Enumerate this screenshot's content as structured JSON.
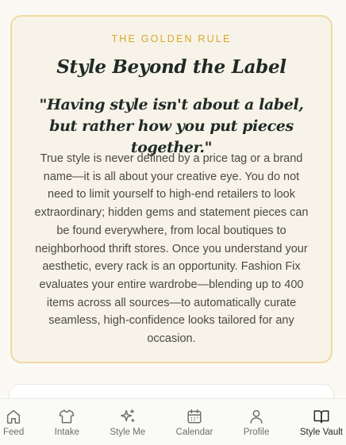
{
  "golden_rule": {
    "eyebrow": "THE GOLDEN RULE",
    "title": "Style Beyond the Label",
    "quote": "\"Having style isn't about a label, but rather how you put pieces together.\"",
    "body": "True style is never defined by a price tag or a brand name—it is all about your creative eye. You do not need to limit yourself to high-end retailers to look extraordinary; hidden gems and statement pieces can be found everywhere, from local boutiques to neighborhood thrift stores. Once you understand your aesthetic, every rack is an opportunity. Fashion Fix evaluates your entire wardrobe—blending up to 400 items across all sources—to automatically curate seamless, high-confidence looks tailored for any occasion."
  },
  "colors": {
    "accent_gold": "#d4a92b",
    "card_border": "#eed9a0",
    "card_bg": "#f8f3e8",
    "heading": "#1f2a26"
  },
  "tab_bar": {
    "active": "Style Vault",
    "tabs": [
      {
        "label": "Feed",
        "icon": "home-icon"
      },
      {
        "label": "Intake",
        "icon": "shirt-icon"
      },
      {
        "label": "Style Me",
        "icon": "sparkles-icon"
      },
      {
        "label": "Calendar",
        "icon": "calendar-icon"
      },
      {
        "label": "Profile",
        "icon": "user-icon"
      },
      {
        "label": "Style Vault",
        "icon": "book-open-icon"
      }
    ]
  }
}
